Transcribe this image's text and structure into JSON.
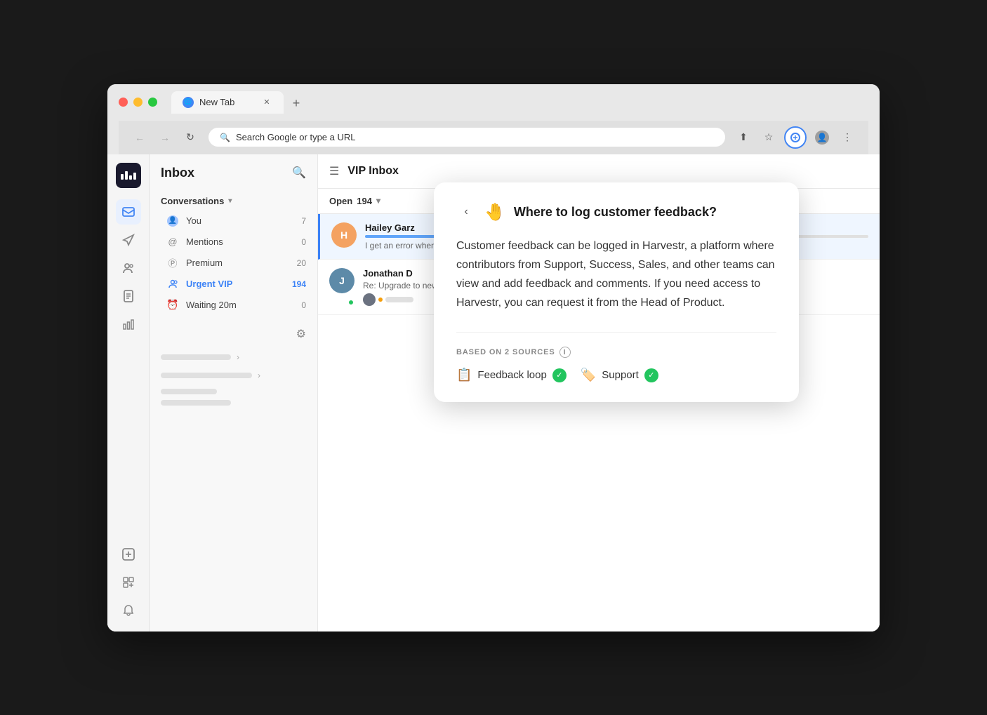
{
  "browser": {
    "tab_label": "New Tab",
    "url_placeholder": "Search Google or type a URL",
    "url_text": "Search Google or type a URL"
  },
  "sidebar_icons": {
    "inbox_label": "Inbox",
    "sent_label": "Sent",
    "contacts_label": "Contacts",
    "docs_label": "Docs",
    "reports_label": "Reports",
    "compose_label": "Compose",
    "apps_label": "Apps",
    "notifications_label": "Notifications"
  },
  "left_sidebar": {
    "title": "Inbox",
    "conversations_label": "Conversations",
    "items": [
      {
        "label": "You",
        "count": "7",
        "icon": "👤",
        "active": false
      },
      {
        "label": "Mentions",
        "count": "0",
        "icon": "@",
        "active": false
      },
      {
        "label": "Premium",
        "count": "20",
        "icon": "©",
        "active": false
      },
      {
        "label": "Urgent VIP",
        "count": "194",
        "icon": "👥",
        "active": true
      },
      {
        "label": "Waiting 20m",
        "count": "0",
        "icon": "⏰",
        "active": false
      }
    ]
  },
  "inbox": {
    "title": "VIP Inbox",
    "open_label": "Open",
    "open_count": "194",
    "conversations": [
      {
        "name": "Hailey Garz",
        "preview": "I get an error when",
        "avatar_color": "#f4a261",
        "avatar_text": "H",
        "has_progress": true,
        "active": true
      },
      {
        "name": "Jonathan D",
        "preview": "Re: Upgrade to new",
        "avatar_color": "#5d8aa8",
        "avatar_text": "J",
        "has_progress": false,
        "online": true,
        "active": false
      }
    ]
  },
  "knowledge_card": {
    "title": "Where to log customer feedback?",
    "icon": "🤚",
    "body": "Customer feedback can be logged in Harvestr, a platform where contributors from Support, Success, Sales, and other teams can view and add feedback and comments. If you need access to Harvestr, you can request it from the Head of Product.",
    "sources_label": "BASED ON 2 SOURCES",
    "sources": [
      {
        "label": "Feedback loop",
        "icon": "📋"
      },
      {
        "label": "Support",
        "icon": "🏷️"
      }
    ]
  }
}
